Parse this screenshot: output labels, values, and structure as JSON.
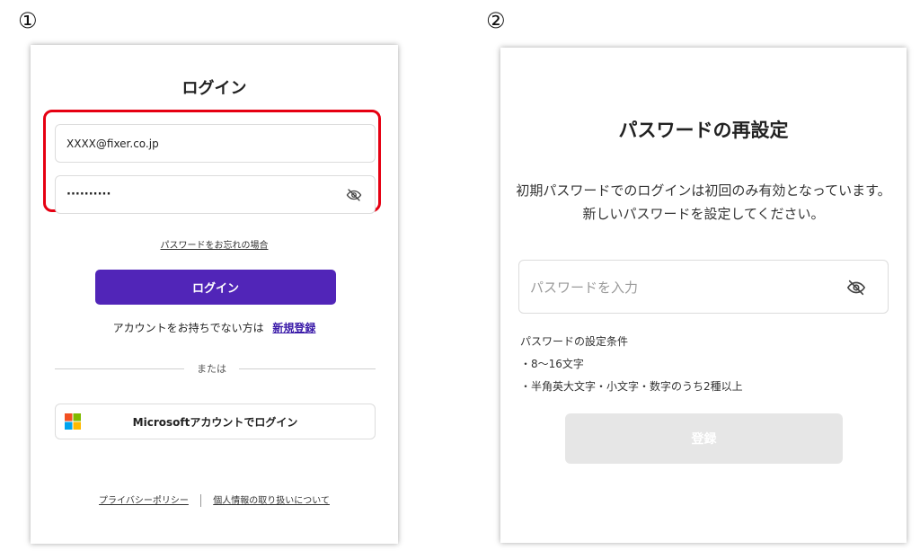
{
  "steps": {
    "step1": "①",
    "step2": "②"
  },
  "login_panel": {
    "title": "ログイン",
    "email_value": "XXXX@fixer.co.jp",
    "password_value": "··········",
    "forgot_password": "パスワードをお忘れの場合",
    "login_button": "ログイン",
    "no_account_text": "アカウントをお持ちでない方は",
    "signup_link": "新規登録",
    "divider_text": "または",
    "microsoft_button": "Microsoftアカウントでログイン",
    "privacy_link": "プライバシーポリシー",
    "personal_info_link": "個人情報の取り扱いについて",
    "icons": [
      "eye-off-icon",
      "microsoft-logo-icon"
    ],
    "colors": {
      "primary": "#5125b8",
      "highlight": "#e60012"
    }
  },
  "reset_panel": {
    "title": "パスワードの再設定",
    "description_line1": "初期パスワードでのログインは初回のみ有効となっています。",
    "description_line2": "新しいパスワードを設定してください。",
    "password_placeholder": "パスワードを入力",
    "conditions_heading": "パスワードの設定条件",
    "conditions": [
      "・8～16文字",
      "・半角英大文字・小文字・数字のうち2種以上"
    ],
    "register_button": "登録",
    "icons": [
      "eye-off-icon"
    ],
    "colors": {
      "disabled_button": "#e6e6e6"
    }
  }
}
